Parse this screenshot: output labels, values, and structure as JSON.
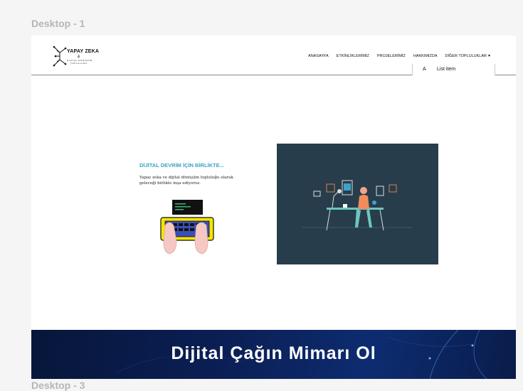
{
  "canvas": {
    "frame1_label": "Desktop - 1",
    "frame3_label": "Desktop - 3"
  },
  "logo": {
    "title": "YAPAY ZEKA",
    "amp": "&",
    "subtitle_line1": "DİJİTAL DÖNÜŞÜM",
    "subtitle_line2": "TOPLULUĞU"
  },
  "nav": {
    "items": [
      "ANASAYFA",
      "ETKİNLİKLERİMİZ",
      "PROJELERİMİZ",
      "HAKKIMIZDA",
      "DİĞER TOPLULUKLAR"
    ]
  },
  "dropdown": {
    "letter": "A",
    "item_label": "List item"
  },
  "hero": {
    "title": "DİJİTAL DEVRİM İÇİN BİRLİKTE...",
    "line1": "Yapay zeka ve dijital dönüşüm topluluğu olarak",
    "line2": "geleceği birlikte inşa ediyoruz."
  },
  "banner": {
    "title": "Dijital Çağın Mimarı Ol"
  },
  "colors": {
    "accent": "#3aa3c7",
    "illustration_bg": "#273d4c",
    "banner_bg": "#0b1f55",
    "keyboard_yellow": "#f5e600"
  }
}
